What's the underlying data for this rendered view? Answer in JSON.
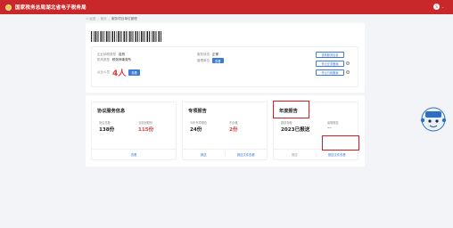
{
  "header": {
    "site_title": "国家税务总局湖北省电子税务局",
    "user_initial": "S",
    "caret": "⌄"
  },
  "breadcrumb": {
    "back": "< 返回",
    "items": [
      "首页",
      "服务项目单位管理"
    ],
    "sep": "/"
  },
  "info": {
    "taxpayer_label": "企业纳税类型",
    "taxpayer_value": "自然",
    "org_type_label": "机构类型",
    "org_type_value": "税务师事务所",
    "status_label": "服务状态",
    "status_value": "正常",
    "manage_label": "管理单位",
    "manage_tag": "查看",
    "people_label": "从业人员",
    "people_value": "4人",
    "people_btn": "查看"
  },
  "side_buttons": [
    "查看服务信息",
    "停止业务备案",
    "停止行政备案"
  ],
  "help_icons": [
    "?",
    "?"
  ],
  "cards": {
    "agreement": {
      "title": "协议服务信息",
      "stat1_label": "协议总数",
      "stat1_value": "138份",
      "stat2_label": "当前到期份",
      "stat2_value": "115份",
      "footer": "查看"
    },
    "special": {
      "title": "专项报告",
      "stat1_label": "今年专项报告",
      "stat1_value": "24份",
      "stat2_label": "不合格",
      "stat2_value": "2份",
      "footer_left": "报送",
      "footer_right": "报送文件查看"
    },
    "annual": {
      "title": "年度报告",
      "stat1_label": "报送年度",
      "stat1_value": "2023已报送",
      "stat2_label": "逾期报告",
      "stat2_value": "--",
      "footer_left": "报送",
      "footer_right": "报送文件查看"
    }
  },
  "colors": {
    "brand": "#c8282a",
    "accent": "#3a7bd5",
    "alert": "#e23a3a"
  }
}
